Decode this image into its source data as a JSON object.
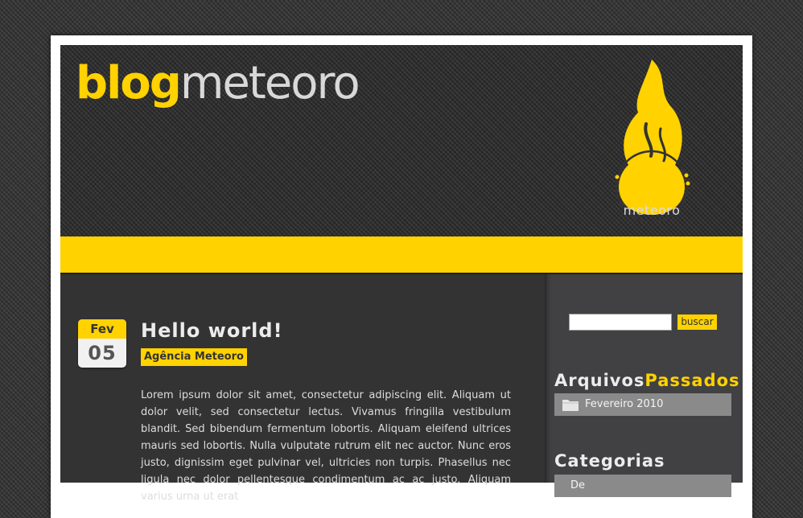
{
  "header": {
    "logo_part1": "blog",
    "logo_part2": "meteoro",
    "brand_name": "meteoro"
  },
  "post": {
    "date_month": "Fev",
    "date_day": "05",
    "title": "Hello world!",
    "author": "Agência Meteoro",
    "body": "Lorem ipsum dolor sit amet, consectetur adipiscing elit. Aliquam ut dolor velit, sed consectetur lectus. Vivamus fringilla vestibulum blandit. Sed bibendum fermentum lobortis. Aliquam eleifend ultrices mauris sed lobortis. Nulla vulputate rutrum elit nec auctor. Nunc eros justo, dignissim eget pulvinar vel, ultricies non turpis. Phasellus nec ligula nec dolor pellentesque condimentum ac ac justo. Aliquam varius urna ut erat"
  },
  "sidebar": {
    "search_value": "",
    "search_button": "buscar",
    "archives_heading_part1": "Arquivos",
    "archives_heading_part2": "Passados",
    "archives": [
      {
        "label": "Fevereiro 2010",
        "icon": "folder-icon"
      }
    ],
    "categories_heading": "Categorias",
    "categories": [
      {
        "label": "De"
      }
    ]
  },
  "colors": {
    "accent": "#ffd200",
    "header_bg": "#333333",
    "content_bg": "#333333",
    "sidebar_bg": "#414144",
    "list_item_bg": "#8a8a8a"
  }
}
